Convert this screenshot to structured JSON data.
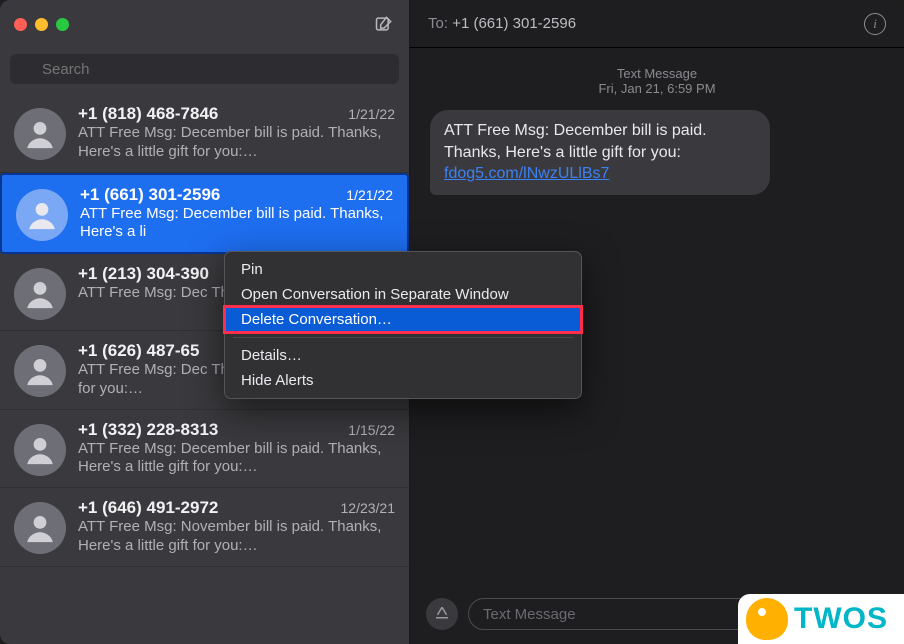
{
  "search": {
    "placeholder": "Search"
  },
  "header": {
    "to_label": "To:",
    "to_value": "+1 (661) 301-2596"
  },
  "timestamp": {
    "line1": "Text Message",
    "line2": "Fri, Jan 21, 6:59 PM"
  },
  "bubble": {
    "text_prefix": "ATT Free Msg: December bill is paid. Thanks,  Here's a little gift for you: ",
    "link_text": "fdog5.com/lNwzULlBs7"
  },
  "composer": {
    "placeholder": "Text Message"
  },
  "context_menu": {
    "pin": "Pin",
    "open_separate": "Open Conversation in Separate Window",
    "delete": "Delete Conversation…",
    "details": "Details…",
    "hide_alerts": "Hide Alerts"
  },
  "conversations": [
    {
      "name": "+1 (818) 468-7846",
      "date": "1/21/22",
      "preview": "ATT Free Msg: December bill is paid. Thanks,  Here's a little gift for you:…"
    },
    {
      "name": "+1 (661) 301-2596",
      "date": "1/21/22",
      "preview": "ATT Free Msg: December bill is paid. Thanks,  Here's a li"
    },
    {
      "name": "+1 (213) 304-390",
      "date": "",
      "preview": "ATT Free Msg: Dec\nThanks,  Here's a li"
    },
    {
      "name": "+1 (626) 487-65",
      "date": "",
      "preview": "ATT Free Msg: Dec\nThanks,  Here's a little gift for you:…"
    },
    {
      "name": "+1 (332) 228-8313",
      "date": "1/15/22",
      "preview": "ATT Free Msg: December bill is paid. Thanks,  Here's a little gift for you:…"
    },
    {
      "name": "+1 (646) 491-2972",
      "date": "12/23/21",
      "preview": "ATT Free Msg: November bill is paid. Thanks,  Here's a little gift for you:…"
    }
  ],
  "watermark": {
    "text": "TWOS"
  }
}
